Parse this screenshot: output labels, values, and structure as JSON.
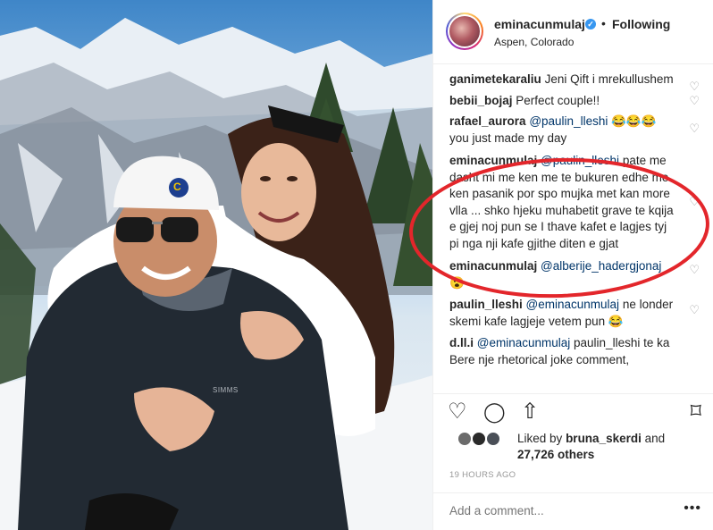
{
  "post": {
    "username": "eminacunmulaj",
    "verified_mark": "✓",
    "separator": "•",
    "follow_status": "Following",
    "location": "Aspen, Colorado"
  },
  "photo": {
    "cap_logo": "C",
    "jacket_brand": "SIMMS"
  },
  "comments": [
    {
      "user": "ganimetekaraliu",
      "mention": "",
      "text": "Jeni Qift i mrekullushem"
    },
    {
      "user": "bebii_bojaj",
      "mention": "",
      "text": "Perfect couple!!"
    },
    {
      "user": "rafael_aurora",
      "mention": "@paulin_lleshi",
      "text": "😂😂😂 you just made my day"
    },
    {
      "user": "eminacunmulaj",
      "mention": "@paulin_lleshi",
      "text": "pate me dasht mi me ken me te bukuren edhe me ken pasanik por spo mujka met kan more vlla ... shko hjeku muhabetit grave te kqija e gjej noj pun se I thave kafet e lagjes tyj pi nga nji kafe gjithe diten e gjat"
    },
    {
      "user": "eminacunmulaj",
      "mention": "@alberije_hadergjonaj",
      "text": "😮"
    },
    {
      "user": "paulin_lleshi",
      "mention": "@eminacunmulaj",
      "text": "ne londer skemi kafe lagjeje vetem pun 😂"
    },
    {
      "user": "d.ll.i",
      "mention": "@eminacunmulaj",
      "text": "paulin_lleshi te ka Bere nje rhetorical joke comment,"
    }
  ],
  "icons": {
    "heart": "♡",
    "like": "♡",
    "comment": "◯",
    "share": "⇧",
    "bookmark": "⌑",
    "more": "•••"
  },
  "likes": {
    "prefix": "Liked by",
    "user": "bruna_skerdi",
    "and": "and",
    "count": "27,726 others"
  },
  "timestamp": "19 HOURS AGO",
  "add_comment_placeholder": "Add a comment...",
  "colors": {
    "link": "#003569",
    "verified": "#3897f0",
    "annotation": "#e3262b",
    "muted": "#999999"
  }
}
